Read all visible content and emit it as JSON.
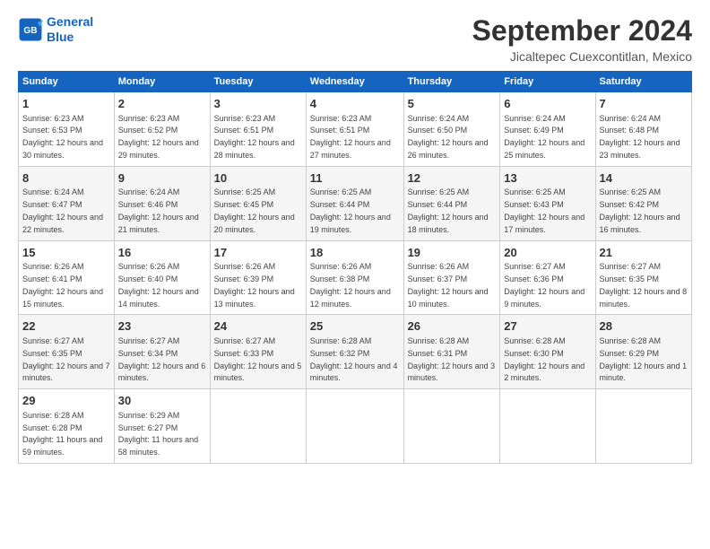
{
  "logo": {
    "line1": "General",
    "line2": "Blue"
  },
  "title": "September 2024",
  "subtitle": "Jicaltepec Cuexcontitlan, Mexico",
  "days_header": [
    "Sunday",
    "Monday",
    "Tuesday",
    "Wednesday",
    "Thursday",
    "Friday",
    "Saturday"
  ],
  "weeks": [
    [
      {
        "day": "1",
        "rise": "6:23 AM",
        "set": "6:53 PM",
        "daylight": "12 hours and 30 minutes."
      },
      {
        "day": "2",
        "rise": "6:23 AM",
        "set": "6:52 PM",
        "daylight": "12 hours and 29 minutes."
      },
      {
        "day": "3",
        "rise": "6:23 AM",
        "set": "6:51 PM",
        "daylight": "12 hours and 28 minutes."
      },
      {
        "day": "4",
        "rise": "6:23 AM",
        "set": "6:51 PM",
        "daylight": "12 hours and 27 minutes."
      },
      {
        "day": "5",
        "rise": "6:24 AM",
        "set": "6:50 PM",
        "daylight": "12 hours and 26 minutes."
      },
      {
        "day": "6",
        "rise": "6:24 AM",
        "set": "6:49 PM",
        "daylight": "12 hours and 25 minutes."
      },
      {
        "day": "7",
        "rise": "6:24 AM",
        "set": "6:48 PM",
        "daylight": "12 hours and 23 minutes."
      }
    ],
    [
      {
        "day": "8",
        "rise": "6:24 AM",
        "set": "6:47 PM",
        "daylight": "12 hours and 22 minutes."
      },
      {
        "day": "9",
        "rise": "6:24 AM",
        "set": "6:46 PM",
        "daylight": "12 hours and 21 minutes."
      },
      {
        "day": "10",
        "rise": "6:25 AM",
        "set": "6:45 PM",
        "daylight": "12 hours and 20 minutes."
      },
      {
        "day": "11",
        "rise": "6:25 AM",
        "set": "6:44 PM",
        "daylight": "12 hours and 19 minutes."
      },
      {
        "day": "12",
        "rise": "6:25 AM",
        "set": "6:44 PM",
        "daylight": "12 hours and 18 minutes."
      },
      {
        "day": "13",
        "rise": "6:25 AM",
        "set": "6:43 PM",
        "daylight": "12 hours and 17 minutes."
      },
      {
        "day": "14",
        "rise": "6:25 AM",
        "set": "6:42 PM",
        "daylight": "12 hours and 16 minutes."
      }
    ],
    [
      {
        "day": "15",
        "rise": "6:26 AM",
        "set": "6:41 PM",
        "daylight": "12 hours and 15 minutes."
      },
      {
        "day": "16",
        "rise": "6:26 AM",
        "set": "6:40 PM",
        "daylight": "12 hours and 14 minutes."
      },
      {
        "day": "17",
        "rise": "6:26 AM",
        "set": "6:39 PM",
        "daylight": "12 hours and 13 minutes."
      },
      {
        "day": "18",
        "rise": "6:26 AM",
        "set": "6:38 PM",
        "daylight": "12 hours and 12 minutes."
      },
      {
        "day": "19",
        "rise": "6:26 AM",
        "set": "6:37 PM",
        "daylight": "12 hours and 10 minutes."
      },
      {
        "day": "20",
        "rise": "6:27 AM",
        "set": "6:36 PM",
        "daylight": "12 hours and 9 minutes."
      },
      {
        "day": "21",
        "rise": "6:27 AM",
        "set": "6:35 PM",
        "daylight": "12 hours and 8 minutes."
      }
    ],
    [
      {
        "day": "22",
        "rise": "6:27 AM",
        "set": "6:35 PM",
        "daylight": "12 hours and 7 minutes."
      },
      {
        "day": "23",
        "rise": "6:27 AM",
        "set": "6:34 PM",
        "daylight": "12 hours and 6 minutes."
      },
      {
        "day": "24",
        "rise": "6:27 AM",
        "set": "6:33 PM",
        "daylight": "12 hours and 5 minutes."
      },
      {
        "day": "25",
        "rise": "6:28 AM",
        "set": "6:32 PM",
        "daylight": "12 hours and 4 minutes."
      },
      {
        "day": "26",
        "rise": "6:28 AM",
        "set": "6:31 PM",
        "daylight": "12 hours and 3 minutes."
      },
      {
        "day": "27",
        "rise": "6:28 AM",
        "set": "6:30 PM",
        "daylight": "12 hours and 2 minutes."
      },
      {
        "day": "28",
        "rise": "6:28 AM",
        "set": "6:29 PM",
        "daylight": "12 hours and 1 minute."
      }
    ],
    [
      {
        "day": "29",
        "rise": "6:28 AM",
        "set": "6:28 PM",
        "daylight": "11 hours and 59 minutes."
      },
      {
        "day": "30",
        "rise": "6:29 AM",
        "set": "6:27 PM",
        "daylight": "11 hours and 58 minutes."
      },
      null,
      null,
      null,
      null,
      null
    ]
  ]
}
